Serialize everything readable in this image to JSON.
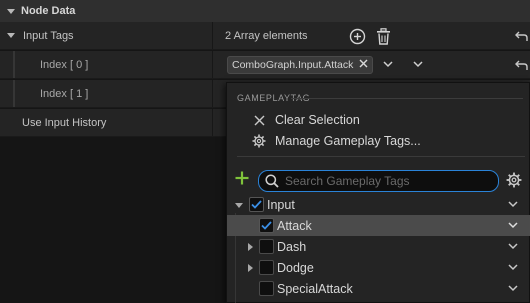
{
  "section": {
    "title": "Node Data"
  },
  "input_tags": {
    "label": "Input Tags",
    "count_text": "2 Array elements"
  },
  "index0": {
    "label": "Index [ 0 ]",
    "tag": "ComboGraph.Input.Attack"
  },
  "index1": {
    "label": "Index [ 1 ]"
  },
  "use_history": {
    "label": "Use Input History"
  },
  "dropdown": {
    "section_label": "GAMEPLAYTAG",
    "clear_selection": "Clear Selection",
    "manage_tags": "Manage Gameplay Tags...",
    "search_placeholder": "Search Gameplay Tags",
    "tree": [
      {
        "label": "Input",
        "checked": true,
        "expanded": true,
        "level": 0
      },
      {
        "label": "Attack",
        "checked": true,
        "selected": true,
        "level": 1
      },
      {
        "label": "Dash",
        "checked": false,
        "collapsed": true,
        "level": 1
      },
      {
        "label": "Dodge",
        "checked": false,
        "collapsed": true,
        "level": 1
      },
      {
        "label": "SpecialAttack",
        "checked": false,
        "level": 1
      }
    ]
  },
  "colors": {
    "accent_blue": "#2a83d8",
    "add_green": "#7fc23b",
    "selected_row": "#4b4b4b"
  },
  "icons": {
    "add": "plus-circle-icon",
    "delete": "trash-icon",
    "reset": "reset-arrow-icon",
    "clear": "close-icon",
    "manage": "gear-icon",
    "search": "search-icon",
    "settings": "gear-icon"
  }
}
